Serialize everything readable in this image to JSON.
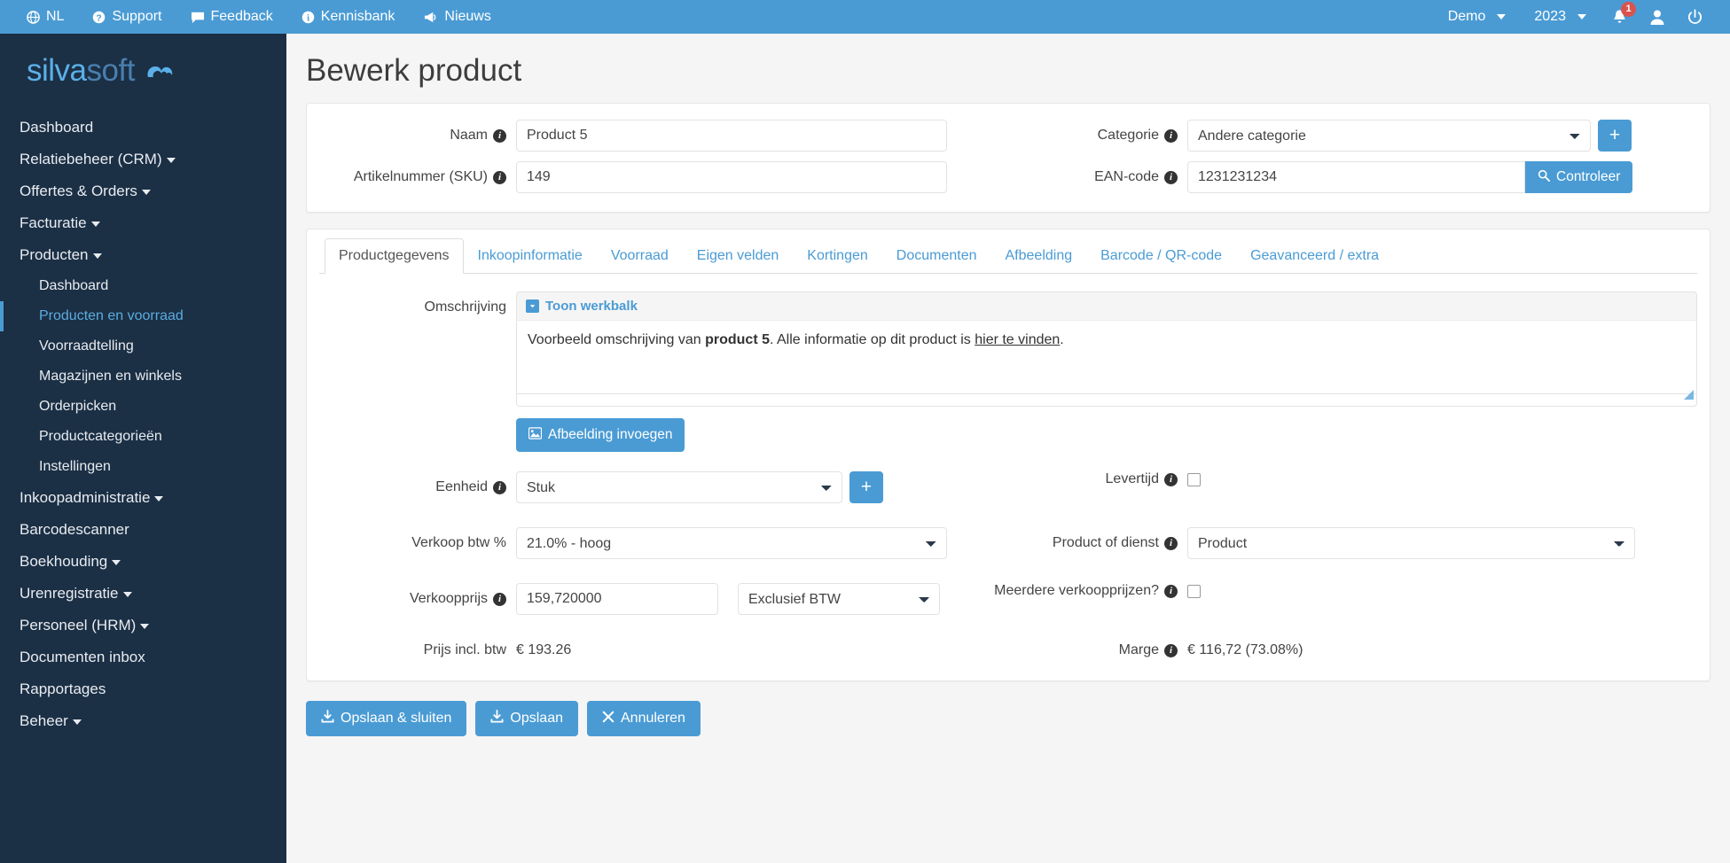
{
  "topbar": {
    "left_items": [
      {
        "label": "NL",
        "icon": "globe-icon"
      },
      {
        "label": "Support",
        "icon": "question-circle-icon"
      },
      {
        "label": "Feedback",
        "icon": "comment-icon"
      },
      {
        "label": "Kennisbank",
        "icon": "info-circle-icon"
      },
      {
        "label": "Nieuws",
        "icon": "megaphone-icon"
      }
    ],
    "account_label": "Demo",
    "year_label": "2023",
    "notification_count": "1",
    "icons": {
      "bell": "bell-icon",
      "user": "user-icon",
      "power": "power-icon"
    }
  },
  "sidebar": {
    "logo": {
      "part1": "silva",
      "part2": "soft",
      "mark": "cloud-swoosh-icon"
    },
    "items": [
      {
        "label": "Dashboard",
        "caret": false,
        "sub": false,
        "active": false
      },
      {
        "label": "Relatiebeheer (CRM)",
        "caret": true,
        "sub": false,
        "active": false
      },
      {
        "label": "Offertes & Orders",
        "caret": true,
        "sub": false,
        "active": false
      },
      {
        "label": "Facturatie",
        "caret": true,
        "sub": false,
        "active": false
      },
      {
        "label": "Producten",
        "caret": true,
        "sub": false,
        "active": false
      },
      {
        "label": "Dashboard",
        "caret": false,
        "sub": true,
        "active": false
      },
      {
        "label": "Producten en voorraad",
        "caret": false,
        "sub": true,
        "active": true
      },
      {
        "label": "Voorraadtelling",
        "caret": false,
        "sub": true,
        "active": false
      },
      {
        "label": "Magazijnen en winkels",
        "caret": false,
        "sub": true,
        "active": false
      },
      {
        "label": "Orderpicken",
        "caret": false,
        "sub": true,
        "active": false
      },
      {
        "label": "Productcategorieën",
        "caret": false,
        "sub": true,
        "active": false
      },
      {
        "label": "Instellingen",
        "caret": false,
        "sub": true,
        "active": false
      },
      {
        "label": "Inkoopadministratie",
        "caret": true,
        "sub": false,
        "active": false
      },
      {
        "label": "Barcodescanner",
        "caret": false,
        "sub": false,
        "active": false
      },
      {
        "label": "Boekhouding",
        "caret": true,
        "sub": false,
        "active": false
      },
      {
        "label": "Urenregistratie",
        "caret": true,
        "sub": false,
        "active": false
      },
      {
        "label": "Personeel (HRM)",
        "caret": true,
        "sub": false,
        "active": false
      },
      {
        "label": "Documenten inbox",
        "caret": false,
        "sub": false,
        "active": false
      },
      {
        "label": "Rapportages",
        "caret": false,
        "sub": false,
        "active": false
      },
      {
        "label": "Beheer",
        "caret": true,
        "sub": false,
        "active": false
      }
    ]
  },
  "page": {
    "title": "Bewerk product"
  },
  "header_form": {
    "naam": {
      "label": "Naam",
      "value": "Product 5"
    },
    "sku": {
      "label": "Artikelnummer (SKU)",
      "value": "149"
    },
    "categorie": {
      "label": "Categorie",
      "value": "Andere categorie",
      "add_label": "+"
    },
    "ean": {
      "label": "EAN-code",
      "value": "1231231234",
      "check_label": "Controleer"
    }
  },
  "tabs": [
    {
      "label": "Productgegevens",
      "active": true
    },
    {
      "label": "Inkoopinformatie",
      "active": false
    },
    {
      "label": "Voorraad",
      "active": false
    },
    {
      "label": "Eigen velden",
      "active": false
    },
    {
      "label": "Kortingen",
      "active": false
    },
    {
      "label": "Documenten",
      "active": false
    },
    {
      "label": "Afbeelding",
      "active": false
    },
    {
      "label": "Barcode / QR-code",
      "active": false
    },
    {
      "label": "Geavanceerd / extra",
      "active": false
    }
  ],
  "productgegevens": {
    "omschrijving": {
      "label": "Omschrijving",
      "toolbar_label": "Toon werkbalk",
      "text_before": "Voorbeeld omschrijving van ",
      "text_bold": "product 5",
      "text_middle": ". Alle informatie op dit product is ",
      "text_link": "hier te vinden",
      "text_after": "."
    },
    "insert_image_button": "Afbeelding invoegen",
    "eenheid": {
      "label": "Eenheid",
      "value": "Stuk",
      "add_label": "+"
    },
    "verkoop_btw": {
      "label": "Verkoop btw %",
      "value": "21.0%  -  hoog"
    },
    "verkoopprijs": {
      "label": "Verkoopprijs",
      "value": "159,720000",
      "btw_mode": "Exclusief BTW"
    },
    "prijs_incl_btw": {
      "label": "Prijs incl. btw",
      "value": "€ 193.26"
    },
    "levertijd": {
      "label": "Levertijd",
      "checked": false
    },
    "product_of_dienst": {
      "label": "Product of dienst",
      "value": "Product"
    },
    "meerdere_verkoopprijzen": {
      "label": "Meerdere verkoopprijzen?",
      "checked": false
    },
    "marge": {
      "label": "Marge",
      "value": "€ 116,72 (73.08%)"
    }
  },
  "actions": [
    {
      "label": "Opslaan & sluiten",
      "icon": "save-icon"
    },
    {
      "label": "Opslaan",
      "icon": "save-icon"
    },
    {
      "label": "Annuleren",
      "icon": "close-icon"
    }
  ],
  "colors": {
    "navbar": "#4a9bd4",
    "sidebar": "#1b2f45",
    "accent": "#4a9bd4",
    "badge": "#d9534f",
    "body_bg": "#f5f5f5",
    "active_nav_text": "#5bacdf"
  }
}
